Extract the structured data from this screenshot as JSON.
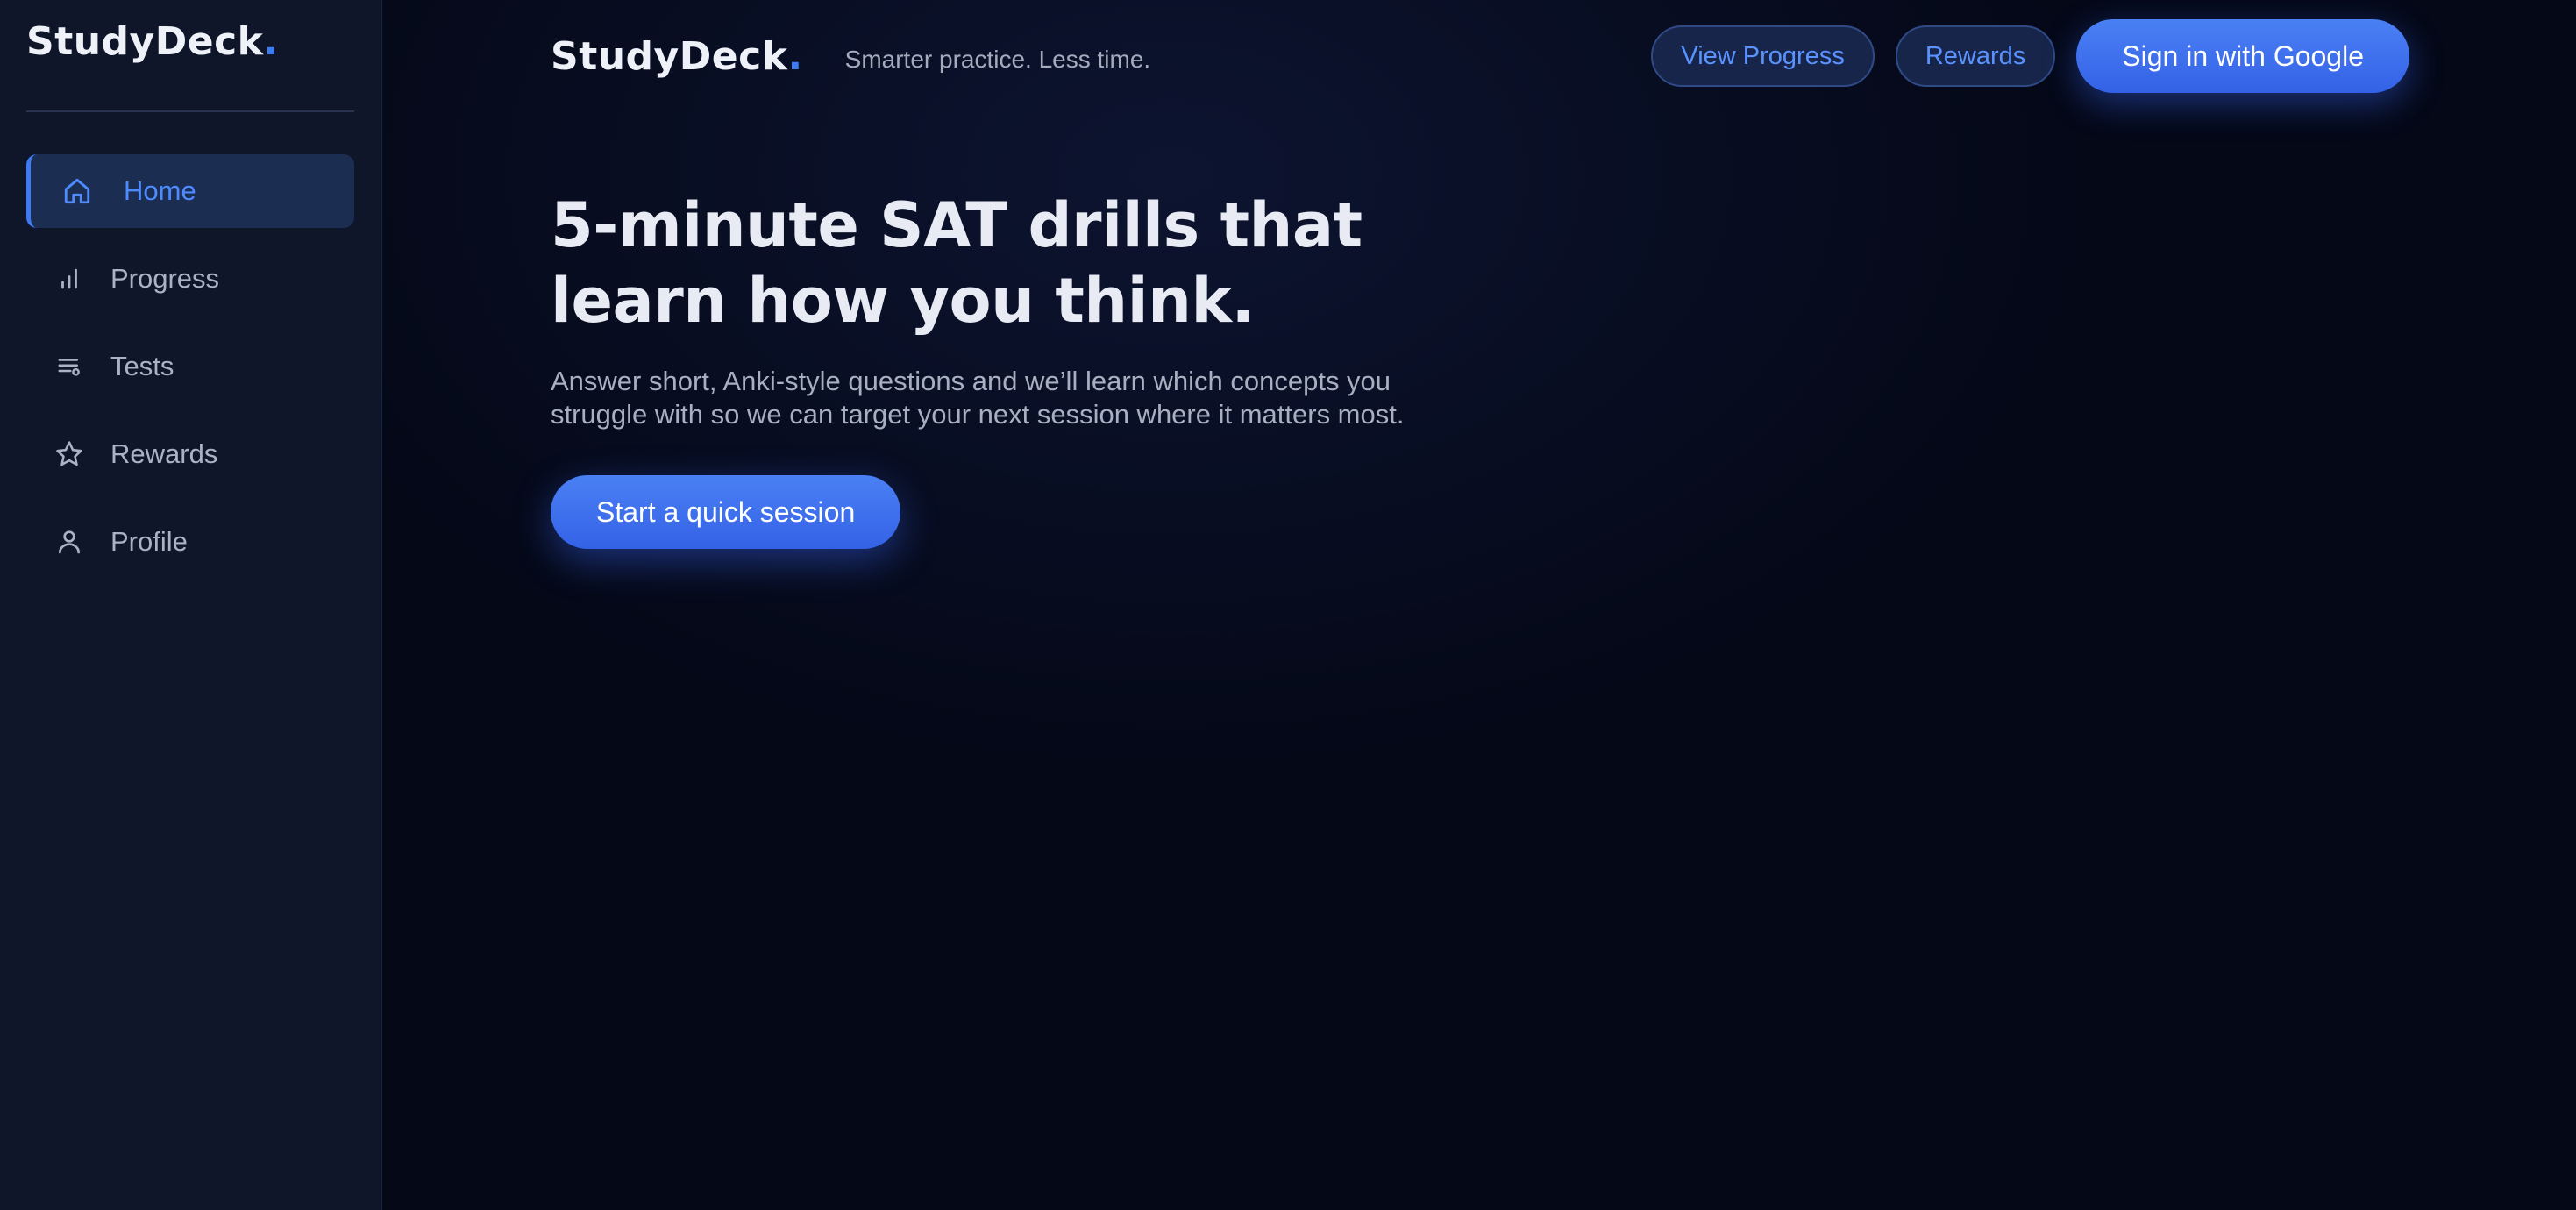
{
  "sidebar": {
    "brand": "StudyDeck",
    "brand_dot": ".",
    "items": [
      {
        "label": "Home",
        "icon": "home-icon",
        "active": true
      },
      {
        "label": "Progress",
        "icon": "bar-chart-icon",
        "active": false
      },
      {
        "label": "Tests",
        "icon": "list-icon",
        "active": false
      },
      {
        "label": "Rewards",
        "icon": "star-icon",
        "active": false
      },
      {
        "label": "Profile",
        "icon": "user-icon",
        "active": false
      }
    ]
  },
  "header": {
    "brand": "StudyDeck",
    "brand_dot": ".",
    "tagline": "Smarter practice. Less time.",
    "view_progress_label": "View Progress",
    "rewards_label": "Rewards",
    "sign_in_label": "Sign in with Google"
  },
  "hero": {
    "title": "5-minute SAT drills that learn how you think.",
    "description": "Answer short, Anki-style questions and we’ll learn which concepts you struggle with so we can target your next session where it matters most.",
    "cta_label": "Start a quick session"
  },
  "colors": {
    "accent": "#3d7bf4",
    "sidebar_bg": "#0f1629",
    "main_bg": "#040817"
  }
}
